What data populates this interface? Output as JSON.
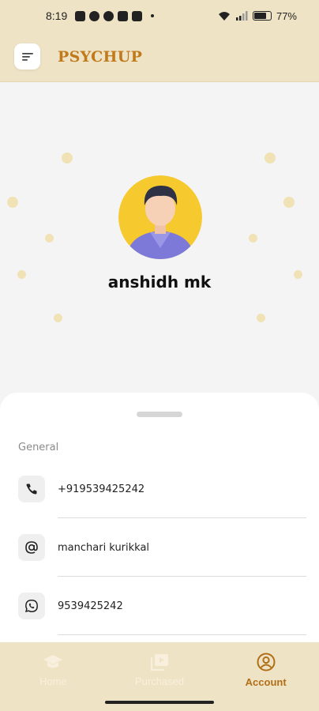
{
  "status": {
    "time": "8:19",
    "battery": "77%",
    "battery_level": 0.77
  },
  "app": {
    "title": "PSYCHUP"
  },
  "profile": {
    "name": "anshidh mk"
  },
  "sheet": {
    "section_label": "General",
    "items": [
      {
        "icon": "phone-icon",
        "value": "+919539425242"
      },
      {
        "icon": "at-sign-icon",
        "value": "manchari kurikkal"
      },
      {
        "icon": "whatsapp-icon",
        "value": "9539425242"
      }
    ]
  },
  "nav": {
    "items": [
      {
        "icon": "graduation-cap-icon",
        "label": "Home",
        "active": false
      },
      {
        "icon": "playlist-icon",
        "label": "Purchased",
        "active": false
      },
      {
        "icon": "account-circle-icon",
        "label": "Account",
        "active": true
      }
    ]
  },
  "colors": {
    "app_bar": "#efe3c6",
    "brand": "#c07a1b",
    "active_nav": "#b06f16"
  }
}
